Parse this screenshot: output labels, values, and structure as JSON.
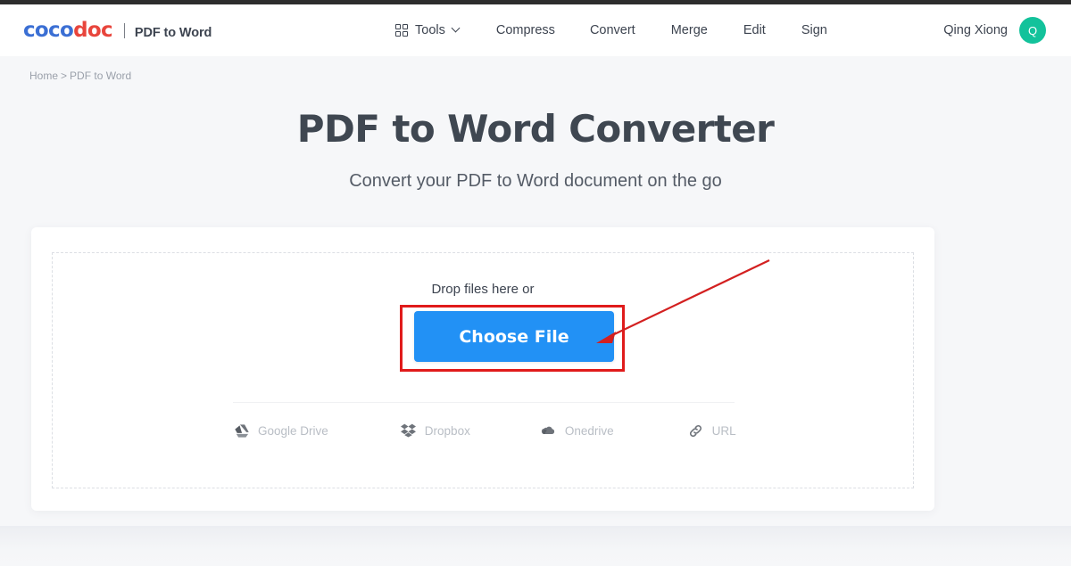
{
  "brand": {
    "logo_part1": "coco",
    "logo_part2": "doc",
    "logo_color_blue": "#3b6fd4",
    "logo_color_red": "#e8453c",
    "product": "PDF to Word"
  },
  "nav": {
    "tools": {
      "label": "Tools",
      "icon": "grid-icon",
      "chevron": "chevron-down-icon"
    },
    "items": [
      {
        "label": "Compress"
      },
      {
        "label": "Convert"
      },
      {
        "label": "Merge"
      },
      {
        "label": "Edit"
      },
      {
        "label": "Sign"
      }
    ]
  },
  "user": {
    "name": "Qing Xiong",
    "avatar_initial": "Q",
    "avatar_color": "#13c29b"
  },
  "breadcrumb": {
    "home": "Home",
    "separator": ">",
    "current": "PDF to Word"
  },
  "hero": {
    "title": "PDF to Word Converter",
    "subtitle": "Convert your PDF to Word document on the go"
  },
  "uploader": {
    "drop_label": "Drop files here or",
    "choose_button": "Choose File",
    "button_color": "#2291f5",
    "cloud_options": [
      {
        "label": "Google Drive",
        "icon": "google-drive-icon"
      },
      {
        "label": "Dropbox",
        "icon": "dropbox-icon"
      },
      {
        "label": "Onedrive",
        "icon": "onedrive-icon"
      },
      {
        "label": "URL",
        "icon": "link-icon"
      }
    ]
  },
  "annotation": {
    "highlight_color": "#e01b1b",
    "arrow_color": "#d32020"
  }
}
